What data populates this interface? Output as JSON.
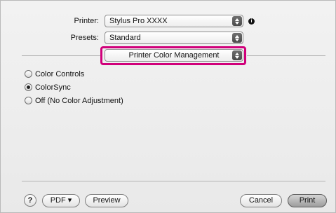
{
  "printer": {
    "label": "Printer:",
    "value": "Stylus Pro XXXX",
    "info_icon": "info-icon"
  },
  "presets": {
    "label": "Presets:",
    "value": "Standard"
  },
  "panel": {
    "value": "Printer Color Management",
    "highlight_color": "#d0007a"
  },
  "options": [
    {
      "label": "Color Controls",
      "selected": false
    },
    {
      "label": "ColorSync",
      "selected": true
    },
    {
      "label": "Off (No Color Adjustment)",
      "selected": false
    }
  ],
  "footer": {
    "help_label": "?",
    "pdf_label": "PDF ▾",
    "preview_label": "Preview",
    "cancel_label": "Cancel",
    "print_label": "Print"
  }
}
